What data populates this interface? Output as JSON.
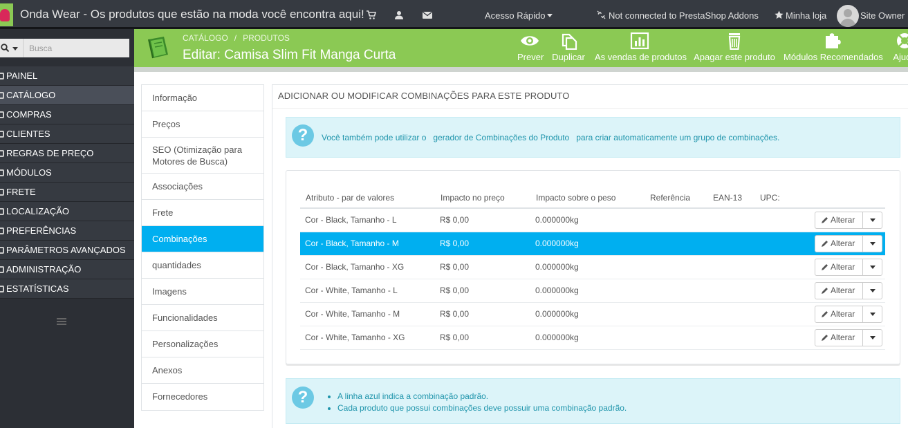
{
  "header": {
    "shop_title": "Onda Wear - Os produtos que estão na moda você encontra aqui!",
    "quick_access": "Acesso Rápido",
    "addons_status": "Not connected to PrestaShop Addons",
    "my_store": "Minha loja",
    "user": "Site Owner",
    "icons": [
      "cart-icon",
      "user-icon",
      "envelope-icon",
      "unlink-icon",
      "star-icon"
    ]
  },
  "sidebar": {
    "search_placeholder": "Busca",
    "items": [
      {
        "label": "PAINEL"
      },
      {
        "label": "CATÁLOGO"
      },
      {
        "label": "COMPRAS"
      },
      {
        "label": "CLIENTES"
      },
      {
        "label": "REGRAS DE PREÇO"
      },
      {
        "label": "MÓDULOS"
      },
      {
        "label": "FRETE"
      },
      {
        "label": "LOCALIZAÇÃO"
      },
      {
        "label": "PREFERÊNCIAS"
      },
      {
        "label": "PARÂMETROS AVANÇADOS"
      },
      {
        "label": "ADMINISTRAÇÃO"
      },
      {
        "label": "ESTATÍSTICAS"
      }
    ],
    "active_index": 1
  },
  "toolbar": {
    "breadcrumb": [
      "CATÁLOGO",
      "/",
      "PRODUTOS"
    ],
    "title": "Editar: Camisa Slim Fit Manga Curta",
    "buttons": [
      {
        "label": "Prever",
        "icon": "eye-icon"
      },
      {
        "label": "Duplicar",
        "icon": "copy-icon"
      },
      {
        "label": "As vendas de produtos",
        "icon": "chart-icon"
      },
      {
        "label": "Apagar este produto",
        "icon": "trash-icon"
      },
      {
        "label": "Módulos Recomendados",
        "icon": "puzzle-icon"
      },
      {
        "label": "Ajuda",
        "icon": "lifebuoy-icon"
      }
    ]
  },
  "tabs": [
    {
      "label": "Informação"
    },
    {
      "label": "Preços"
    },
    {
      "label": "SEO (Otimização para Motores de Busca)"
    },
    {
      "label": "Associações"
    },
    {
      "label": "Frete"
    },
    {
      "label": "Combinações"
    },
    {
      "label": "quantidades"
    },
    {
      "label": "Imagens"
    },
    {
      "label": "Funcionalidades"
    },
    {
      "label": "Personalizações"
    },
    {
      "label": "Anexos"
    },
    {
      "label": "Fornecedores"
    }
  ],
  "active_tab": 5,
  "panel": {
    "heading": "ADICIONAR OU MODIFICAR COMBINAÇÕES PARA ESTE PRODUTO",
    "info_before": "Você também pode utilizar o",
    "info_link": "gerador de Combinações do Produto",
    "info_after": "para criar automaticamente um grupo de combinações.",
    "columns": [
      "Atributo - par de valores",
      "Impacto no preço",
      "Impacto sobre o peso",
      "Referência",
      "EAN-13",
      "UPC:"
    ],
    "rows": [
      {
        "attribute": "Cor - Black, Tamanho - L",
        "price": "R$ 0,00",
        "weight": "0.000000kg",
        "reference": "",
        "ean13": "",
        "upc": "",
        "default": false
      },
      {
        "attribute": "Cor - Black, Tamanho - M",
        "price": "R$ 0,00",
        "weight": "0.000000kg",
        "reference": "",
        "ean13": "",
        "upc": "",
        "default": true
      },
      {
        "attribute": "Cor - Black, Tamanho - XG",
        "price": "R$ 0,00",
        "weight": "0.000000kg",
        "reference": "",
        "ean13": "",
        "upc": "",
        "default": false
      },
      {
        "attribute": "Cor - White, Tamanho - L",
        "price": "R$ 0,00",
        "weight": "0.000000kg",
        "reference": "",
        "ean13": "",
        "upc": "",
        "default": false
      },
      {
        "attribute": "Cor - White, Tamanho - M",
        "price": "R$ 0,00",
        "weight": "0.000000kg",
        "reference": "",
        "ean13": "",
        "upc": "",
        "default": false
      },
      {
        "attribute": "Cor - White, Tamanho - XG",
        "price": "R$ 0,00",
        "weight": "0.000000kg",
        "reference": "",
        "ean13": "",
        "upc": "",
        "default": false
      }
    ],
    "edit_label": "Alterar",
    "notes": [
      "A linha azul indica a combinação padrão.",
      "Cada produto que possui combinações deve possuir uma combinação padrão."
    ]
  },
  "colors": {
    "toolbar_green": "#8bc954",
    "default_row_blue": "#00aff0",
    "header_dark": "#363a41",
    "sidebar_dark": "#2c2f35",
    "alert_bg": "#dcf4f9"
  }
}
